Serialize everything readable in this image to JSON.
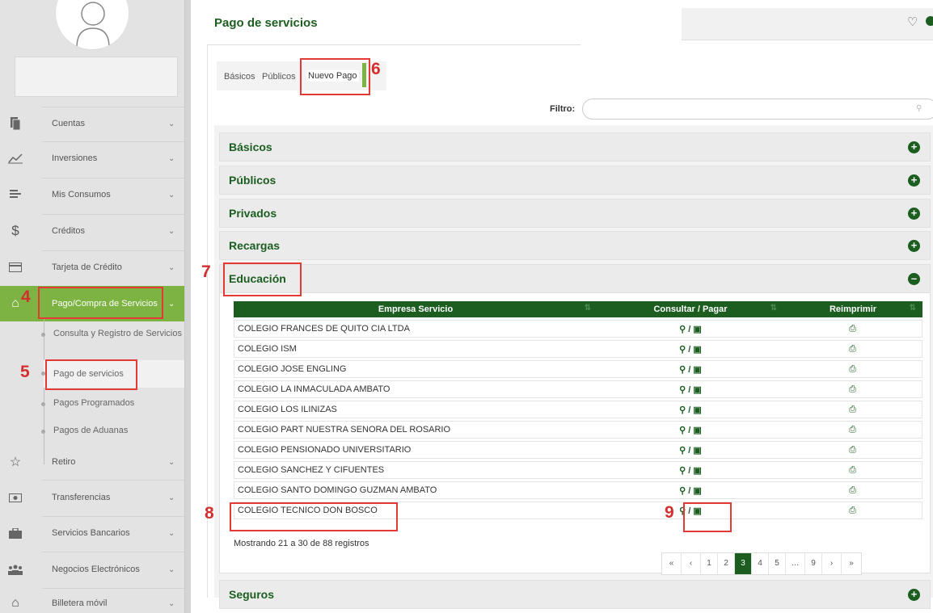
{
  "sidebar": {
    "items": [
      {
        "label": "Cuentas",
        "icon": "document-icon"
      },
      {
        "label": "Inversiones",
        "icon": "chart-line-icon"
      },
      {
        "label": "Mis Consumos",
        "icon": "list-icon"
      },
      {
        "label": "Créditos",
        "icon": "dollar-icon"
      },
      {
        "label": "Tarjeta de Crédito",
        "icon": "credit-card-icon"
      },
      {
        "label": "Pago/Compra de Servicios",
        "icon": "home-icon"
      },
      {
        "label": "Retiro",
        "icon": "star-icon"
      },
      {
        "label": "Transferencias",
        "icon": "money-icon"
      },
      {
        "label": "Servicios Bancarios",
        "icon": "briefcase-icon"
      },
      {
        "label": "Negocios Electrónicos",
        "icon": "users-icon"
      },
      {
        "label": "Billetera móvil",
        "icon": "home-icon"
      }
    ],
    "subitems": [
      {
        "label": "Consulta y Registro de Servicios"
      },
      {
        "label": "Pago de servicios"
      },
      {
        "label": "Pagos Programados"
      },
      {
        "label": "Pagos de Aduanas"
      }
    ]
  },
  "annotations": {
    "n4": "4",
    "n5": "5",
    "n6": "6",
    "n7": "7",
    "n8": "8",
    "n9": "9"
  },
  "header": {
    "title": "Pago de servicios"
  },
  "tabs": [
    {
      "label": "Básicos"
    },
    {
      "label": "Públicos"
    },
    {
      "label": "Nuevo Pago"
    }
  ],
  "filter": {
    "label": "Filtro:",
    "placeholder": ""
  },
  "accordion": [
    {
      "label": "Básicos"
    },
    {
      "label": "Públicos"
    },
    {
      "label": "Privados"
    },
    {
      "label": "Recargas"
    },
    {
      "label": "Educación"
    },
    {
      "label": "Seguros"
    }
  ],
  "table": {
    "columns": [
      "Empresa Servicio",
      "Consultar / Pagar",
      "Reimprimir"
    ],
    "rows": [
      {
        "empresa": "COLEGIO FRANCES DE QUITO CIA LTDA"
      },
      {
        "empresa": "COLEGIO ISM"
      },
      {
        "empresa": "COLEGIO JOSE ENGLING"
      },
      {
        "empresa": "COLEGIO LA INMACULADA AMBATO"
      },
      {
        "empresa": "COLEGIO LOS ILINIZAS"
      },
      {
        "empresa": "COLEGIO PART NUESTRA SENORA DEL ROSARIO"
      },
      {
        "empresa": "COLEGIO PENSIONADO UNIVERSITARIO"
      },
      {
        "empresa": "COLEGIO SANCHEZ Y CIFUENTES"
      },
      {
        "empresa": "COLEGIO SANTO DOMINGO GUZMAN AMBATO"
      },
      {
        "empresa": "COLEGIO TECNICO DON BOSCO"
      }
    ],
    "action_separator": "/",
    "showing": "Mostrando 21 a 30 de 88 registros"
  },
  "pagination": {
    "first": "«",
    "prev": "‹",
    "pages": [
      "1",
      "2",
      "3",
      "4",
      "5",
      "…",
      "9"
    ],
    "current": "3",
    "next": "›",
    "last": "»"
  },
  "colors": {
    "primary_green": "#1b5e20",
    "accent_green": "#7cb342",
    "annotation_red": "#e53935"
  }
}
